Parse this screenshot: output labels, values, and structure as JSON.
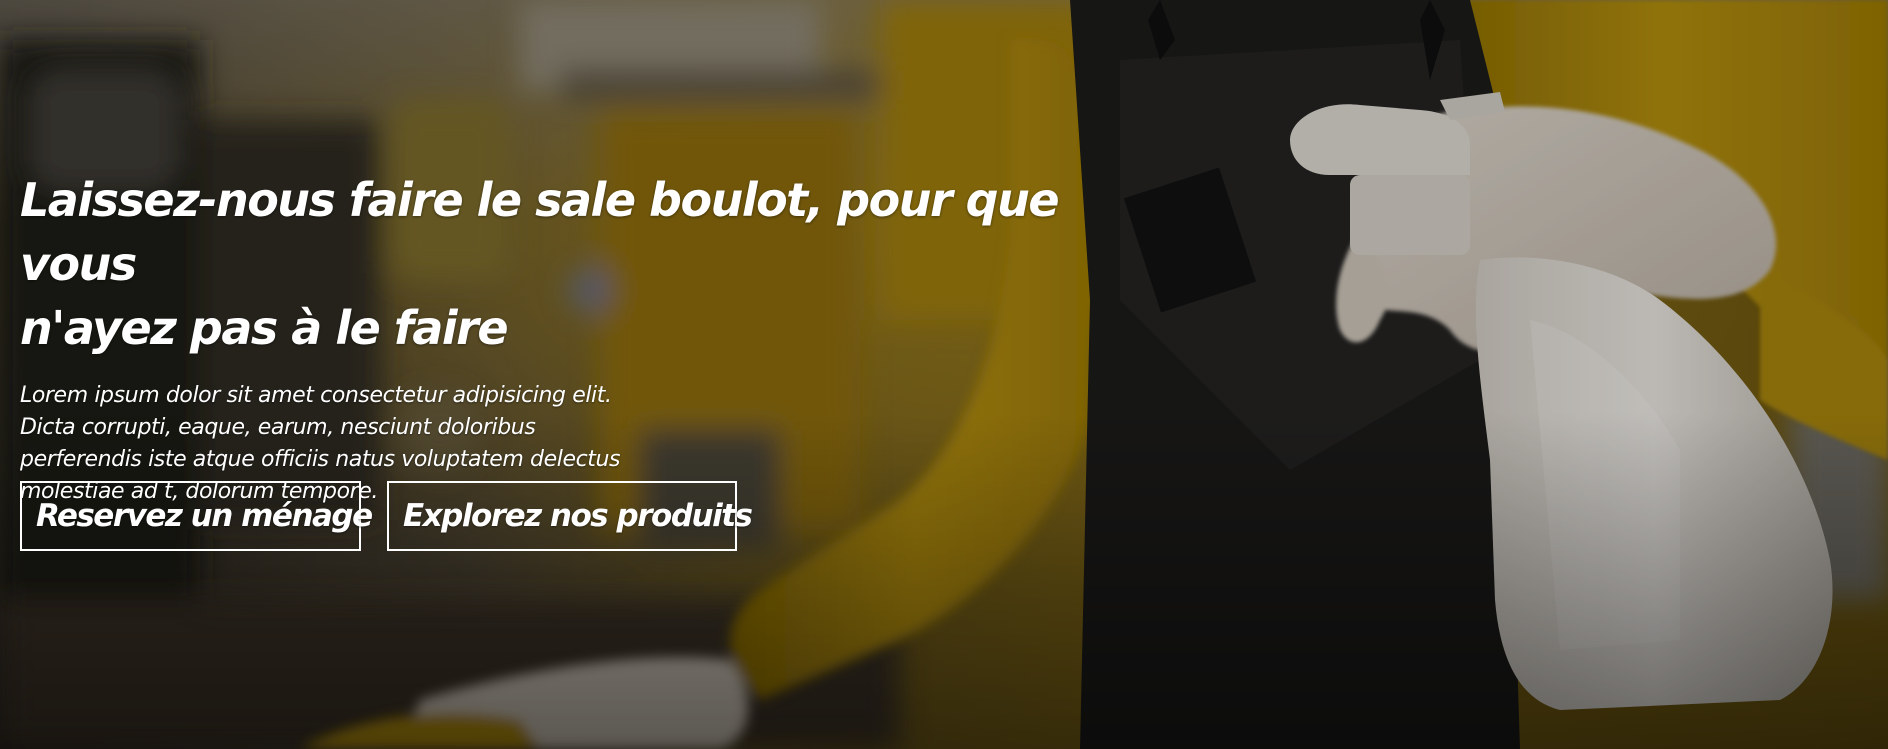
{
  "hero": {
    "title_line1": "Laissez-nous faire le sale boulot, pour que vous",
    "title_line2": "n'ayez pas à le faire",
    "text_line1": "Lorem ipsum dolor sit amet consectetur adipisicing elit.",
    "text_line2": "Dicta corrupti, eaque, earum, nesciunt doloribus",
    "text_line3": "perferendis iste atque officiis natus voluptatem delectus",
    "text_line4": "molestiae ad t, dolorum tempore.",
    "primary_button_label": "Reservez un ménage",
    "secondary_button_label": "Explorez nos produits"
  }
}
